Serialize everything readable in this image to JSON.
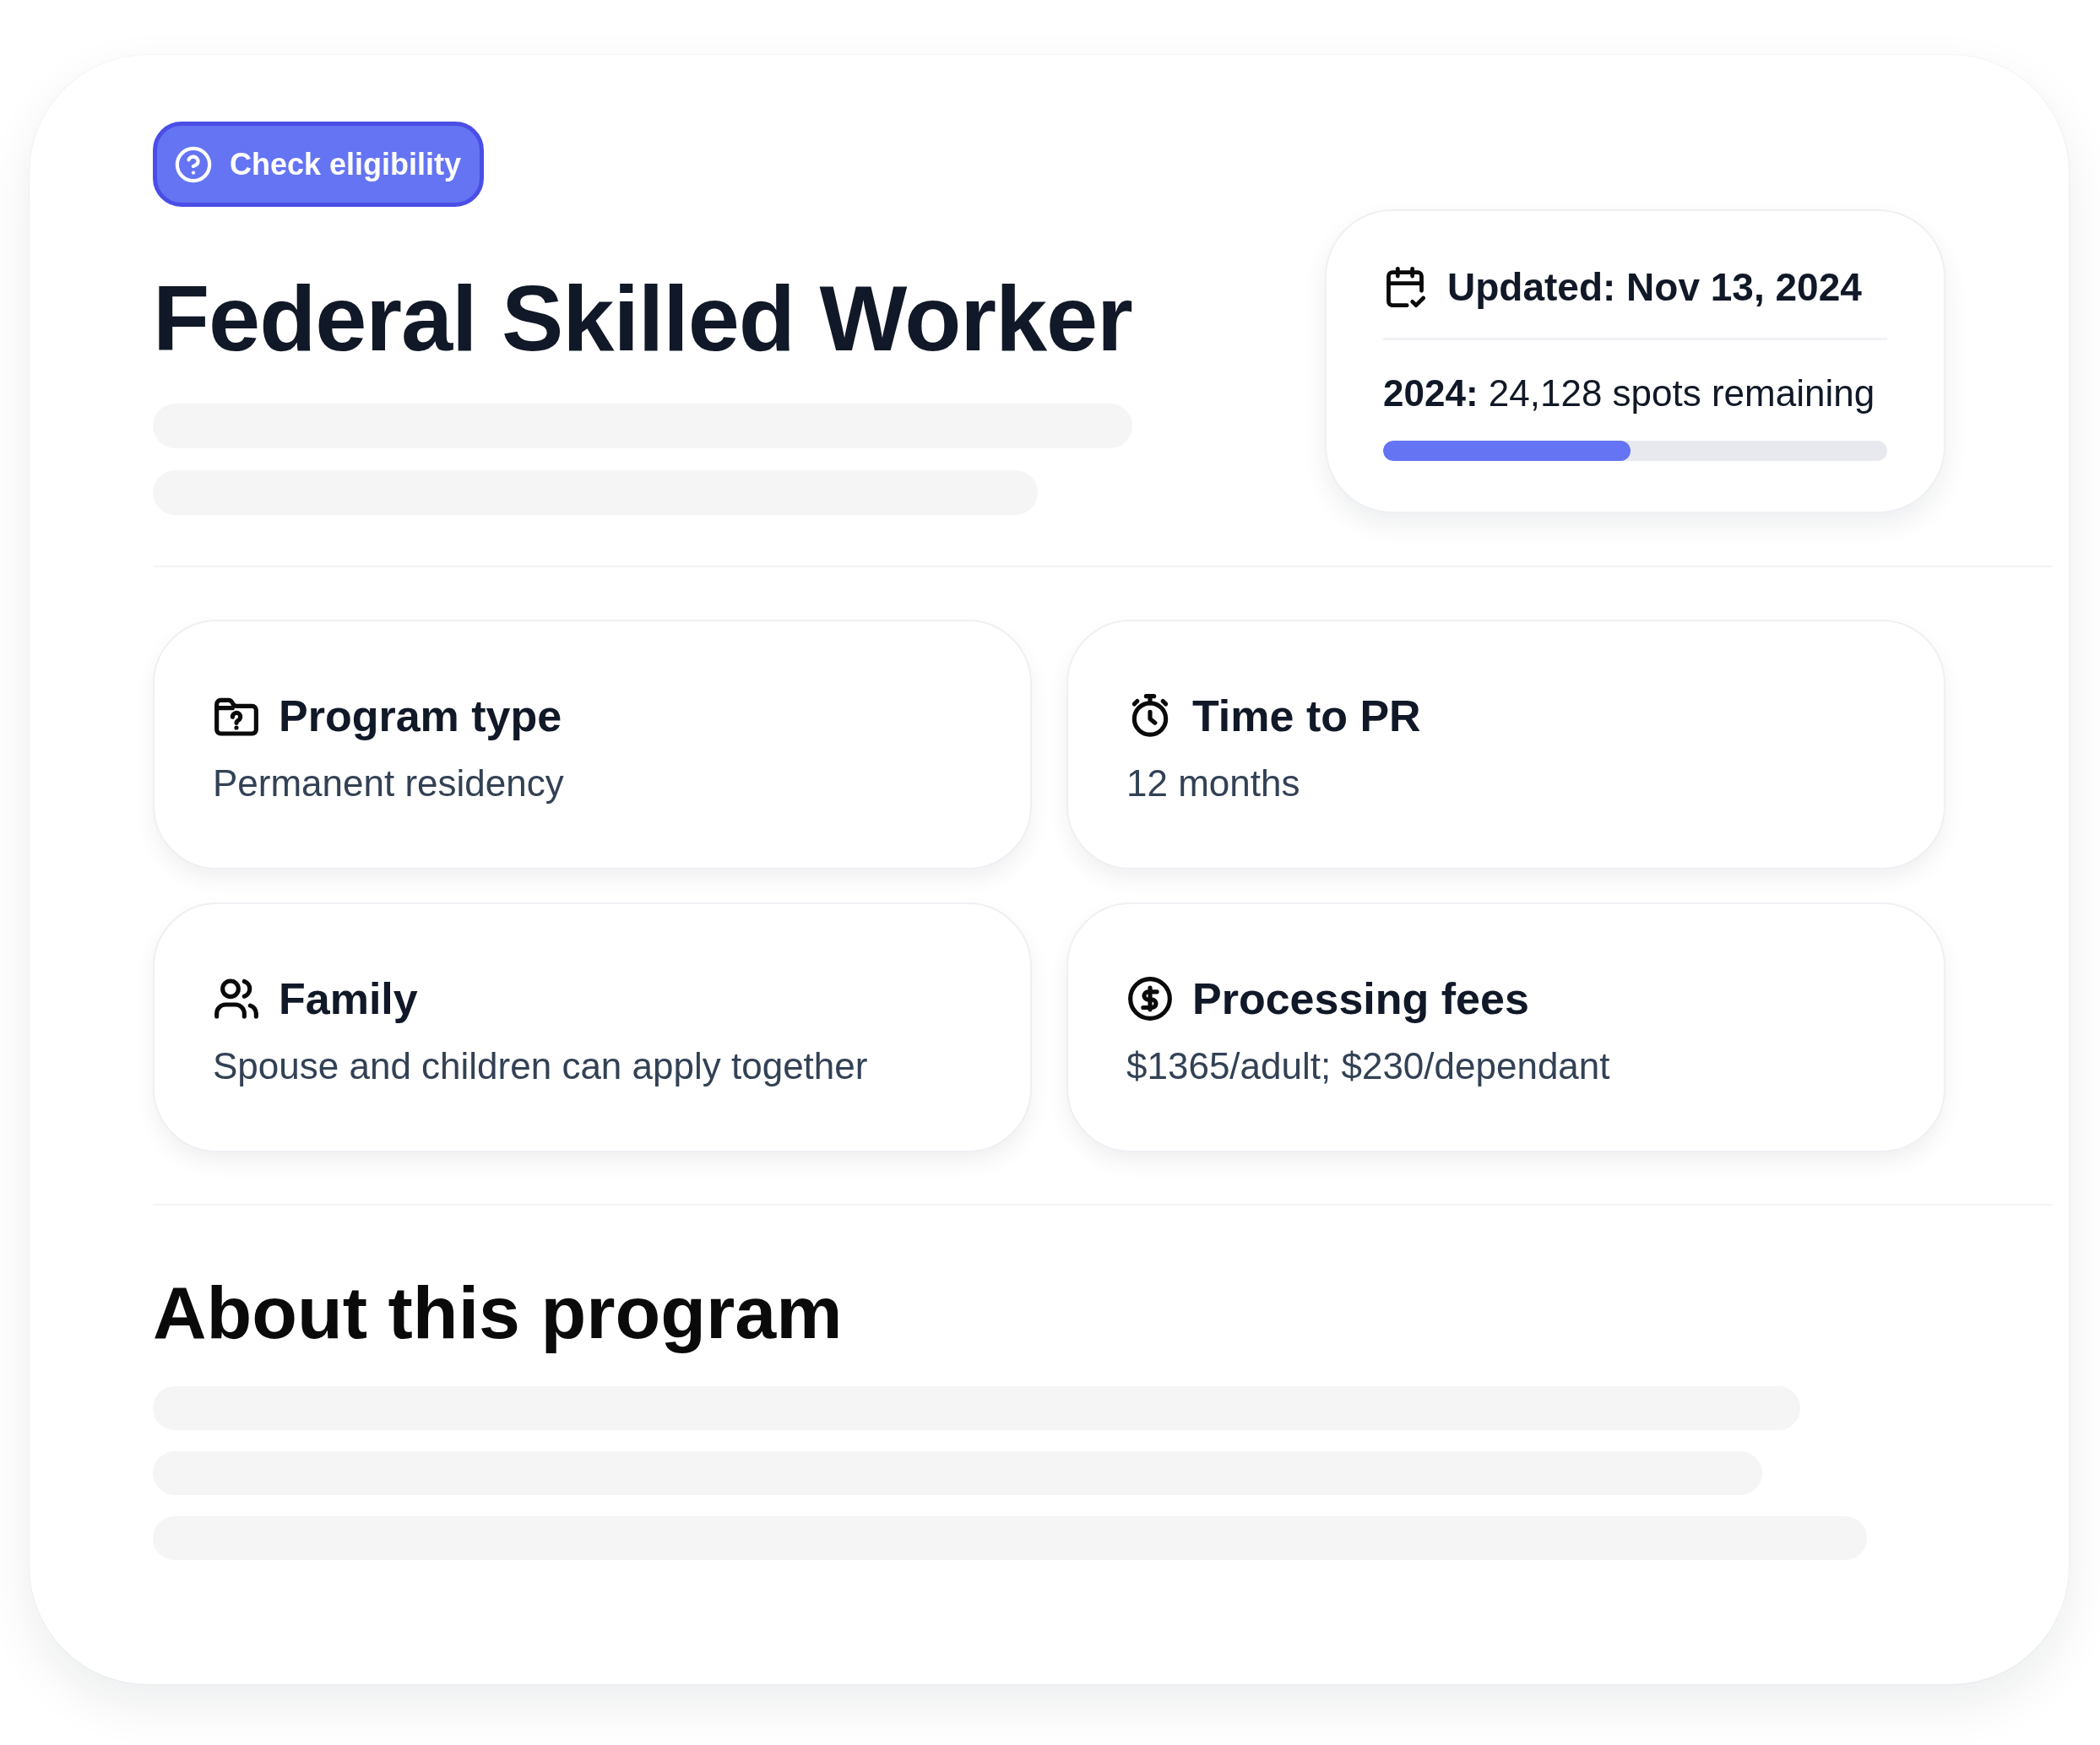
{
  "eligibility_button": {
    "label": "Check eligibility"
  },
  "title": "Federal Skilled Worker",
  "status_card": {
    "updated": "Updated: Nov 13, 2024",
    "quota": "**2024:** 24,128 spots remaining",
    "level": 0.49
  },
  "info_cards": [
    {
      "title": "Program type",
      "value": "Permanent residency"
    },
    {
      "title": "Time to PR",
      "value": "12 months"
    },
    {
      "title": "Family",
      "value": "Spouse and children can apply together"
    },
    {
      "title": "Processing fees",
      "value": "$1365/adult; $230/dependant"
    }
  ],
  "about": {
    "heading": "About this program"
  }
}
